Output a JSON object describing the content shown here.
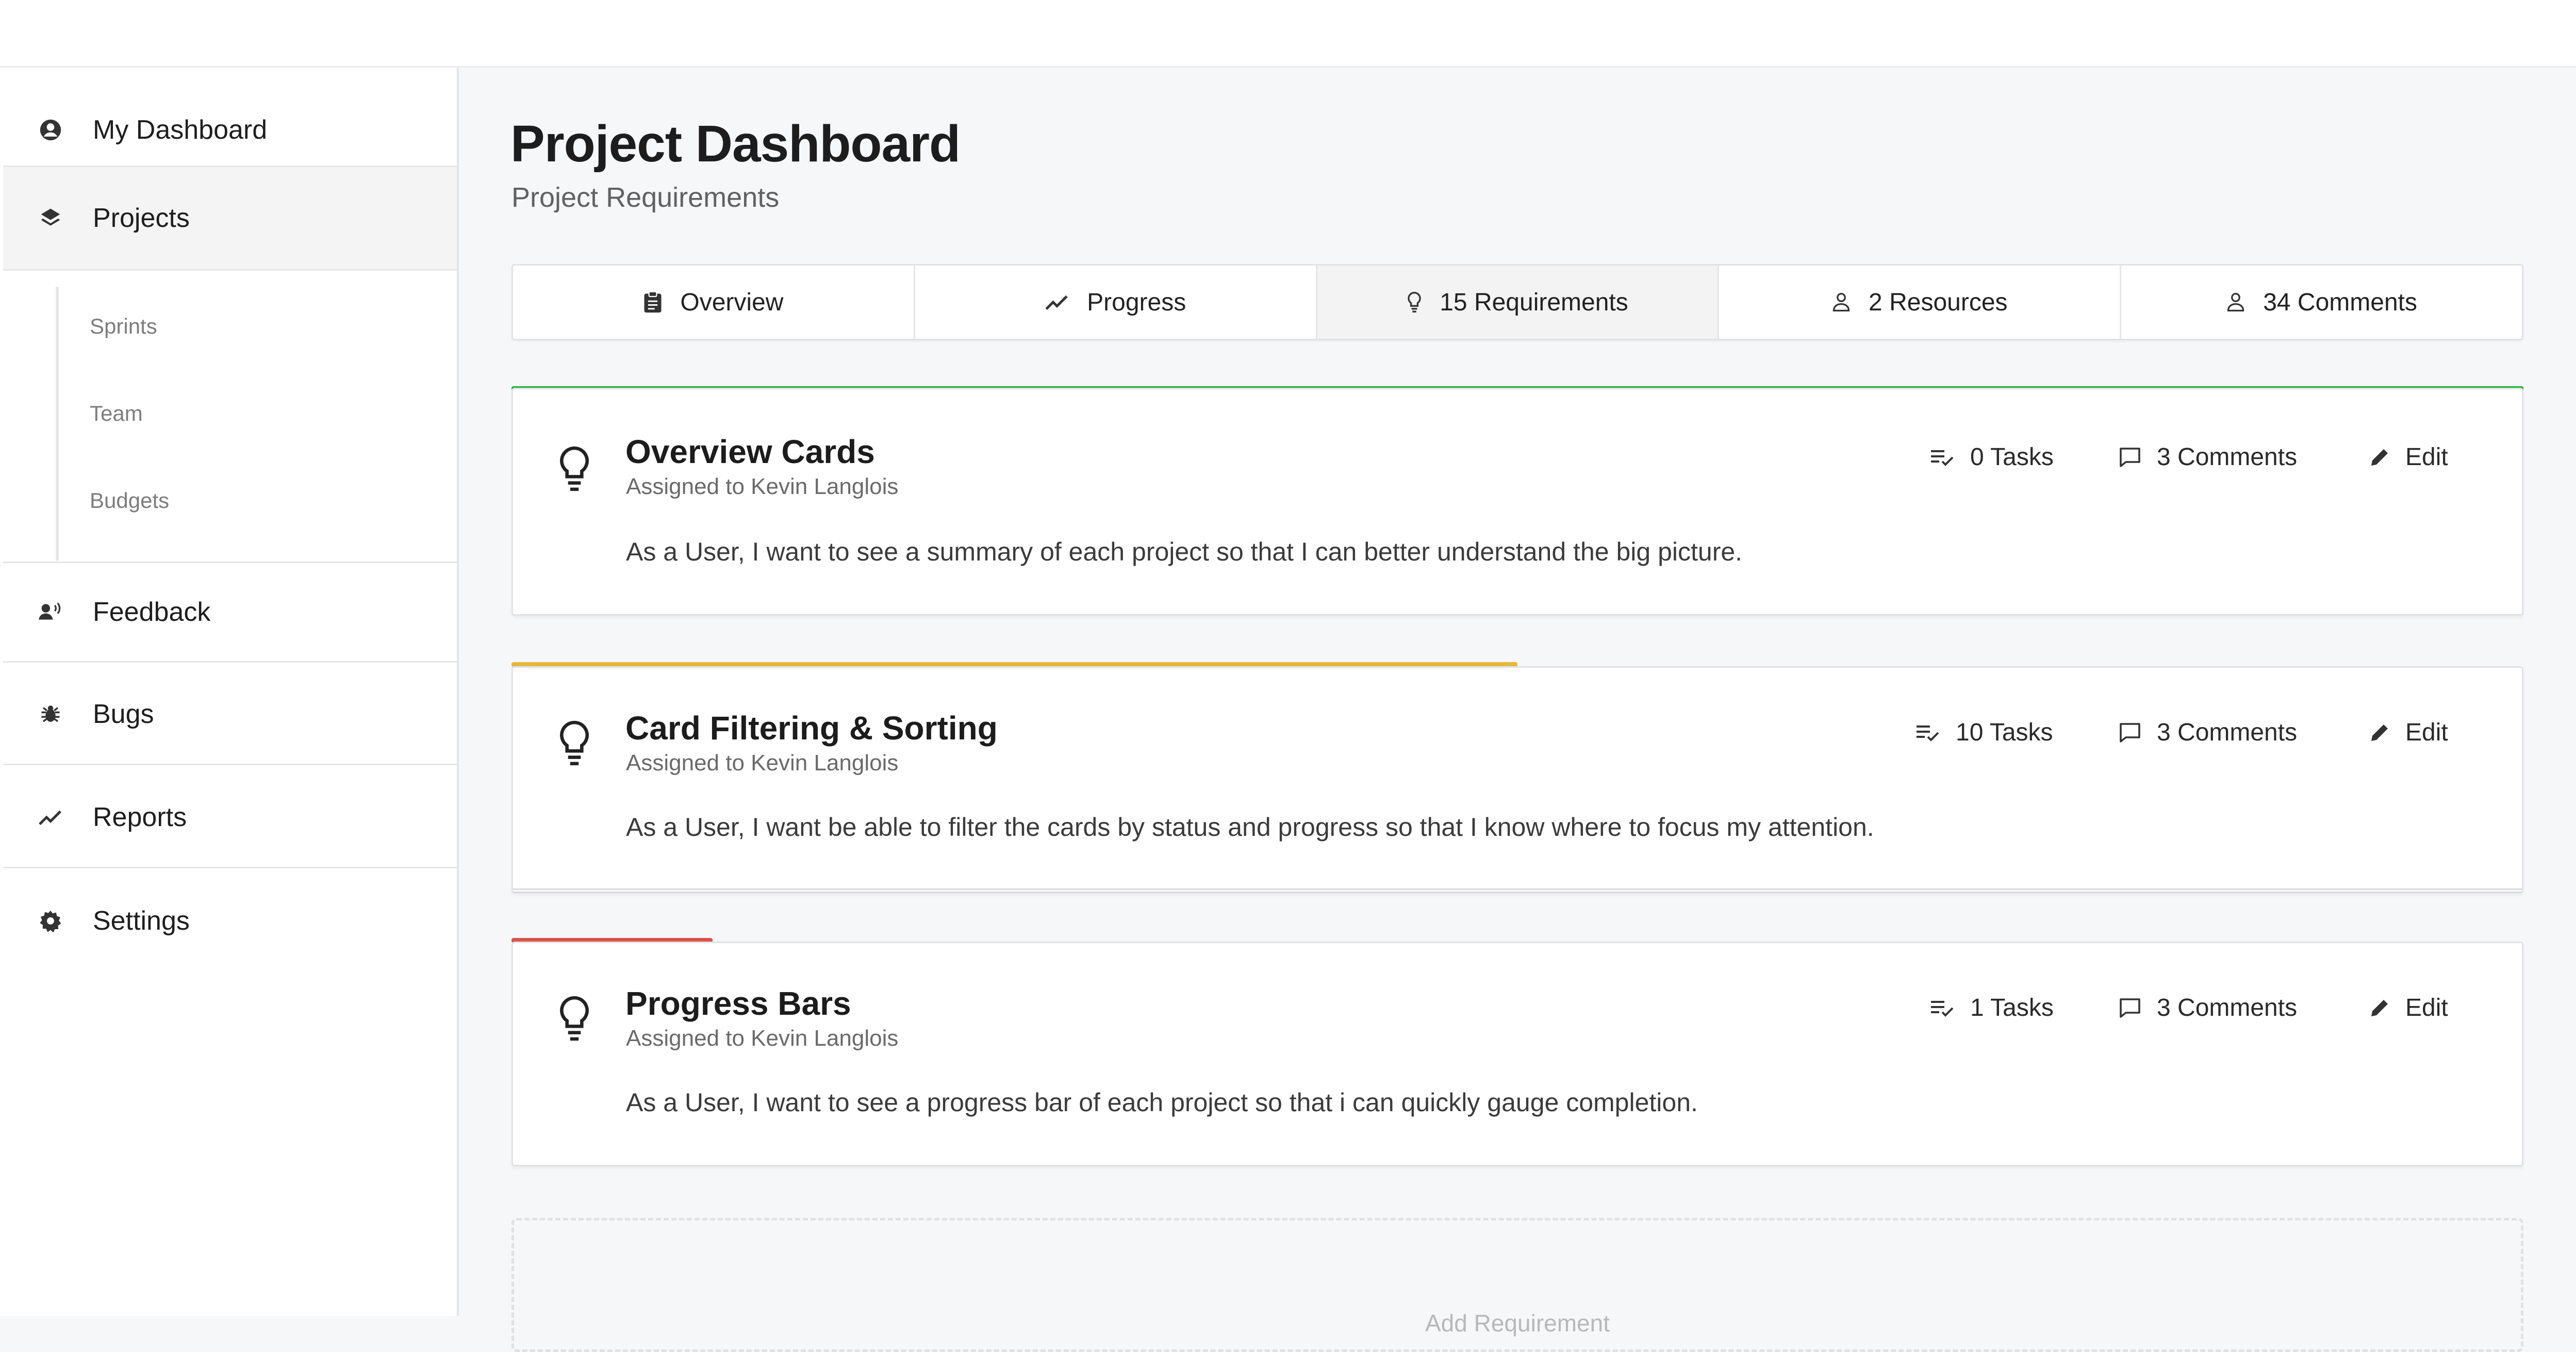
{
  "sidebar": {
    "items": [
      {
        "label": "My Dashboard",
        "icon": "user-circle-icon"
      },
      {
        "label": "Projects",
        "icon": "layers-icon"
      },
      {
        "label": "Feedback",
        "icon": "user-voice-icon"
      },
      {
        "label": "Bugs",
        "icon": "bug-icon"
      },
      {
        "label": "Reports",
        "icon": "trend-line-icon"
      },
      {
        "label": "Settings",
        "icon": "gear-icon"
      }
    ],
    "sub_items": [
      "Sprints",
      "Team",
      "Budgets"
    ]
  },
  "header": {
    "title": "Project Dashboard",
    "subtitle": "Project Requirements"
  },
  "tabs": [
    {
      "label": "Overview",
      "icon": "clipboard-icon"
    },
    {
      "label": "Progress",
      "icon": "trend-line-icon"
    },
    {
      "label": "15 Requirements",
      "icon": "lightbulb-icon"
    },
    {
      "label": "2 Resources",
      "icon": "person-icon"
    },
    {
      "label": "34 Comments",
      "icon": "person-icon"
    }
  ],
  "requirements": [
    {
      "title": "Overview Cards",
      "assignee": "Assigned to Kevin Langlois",
      "description": "As a User, I want to see a summary of each project so that I can better understand the big picture.",
      "tasks": "0 Tasks",
      "comments": "3 Comments",
      "edit": "Edit",
      "progress": 1.0,
      "progress_color": "#1fb141"
    },
    {
      "title": "Card Filtering & Sorting",
      "assignee": "Assigned to Kevin Langlois",
      "description": "As a User, I want be able to filter the cards by status and progress so that I know where to focus my attention.",
      "tasks": "10 Tasks",
      "comments": "3 Comments",
      "edit": "Edit",
      "progress": 0.5,
      "progress_color": "#e5b73f"
    },
    {
      "title": "Progress Bars",
      "assignee": "Assigned to Kevin Langlois",
      "description": "As a User, I want to see a progress bar of each project so that i can quickly gauge completion.",
      "tasks": "1 Tasks",
      "comments": "3 Comments",
      "edit": "Edit",
      "progress": 0.1,
      "progress_color": "#d9534a"
    }
  ],
  "add_requirement_label": "Add Requirement"
}
